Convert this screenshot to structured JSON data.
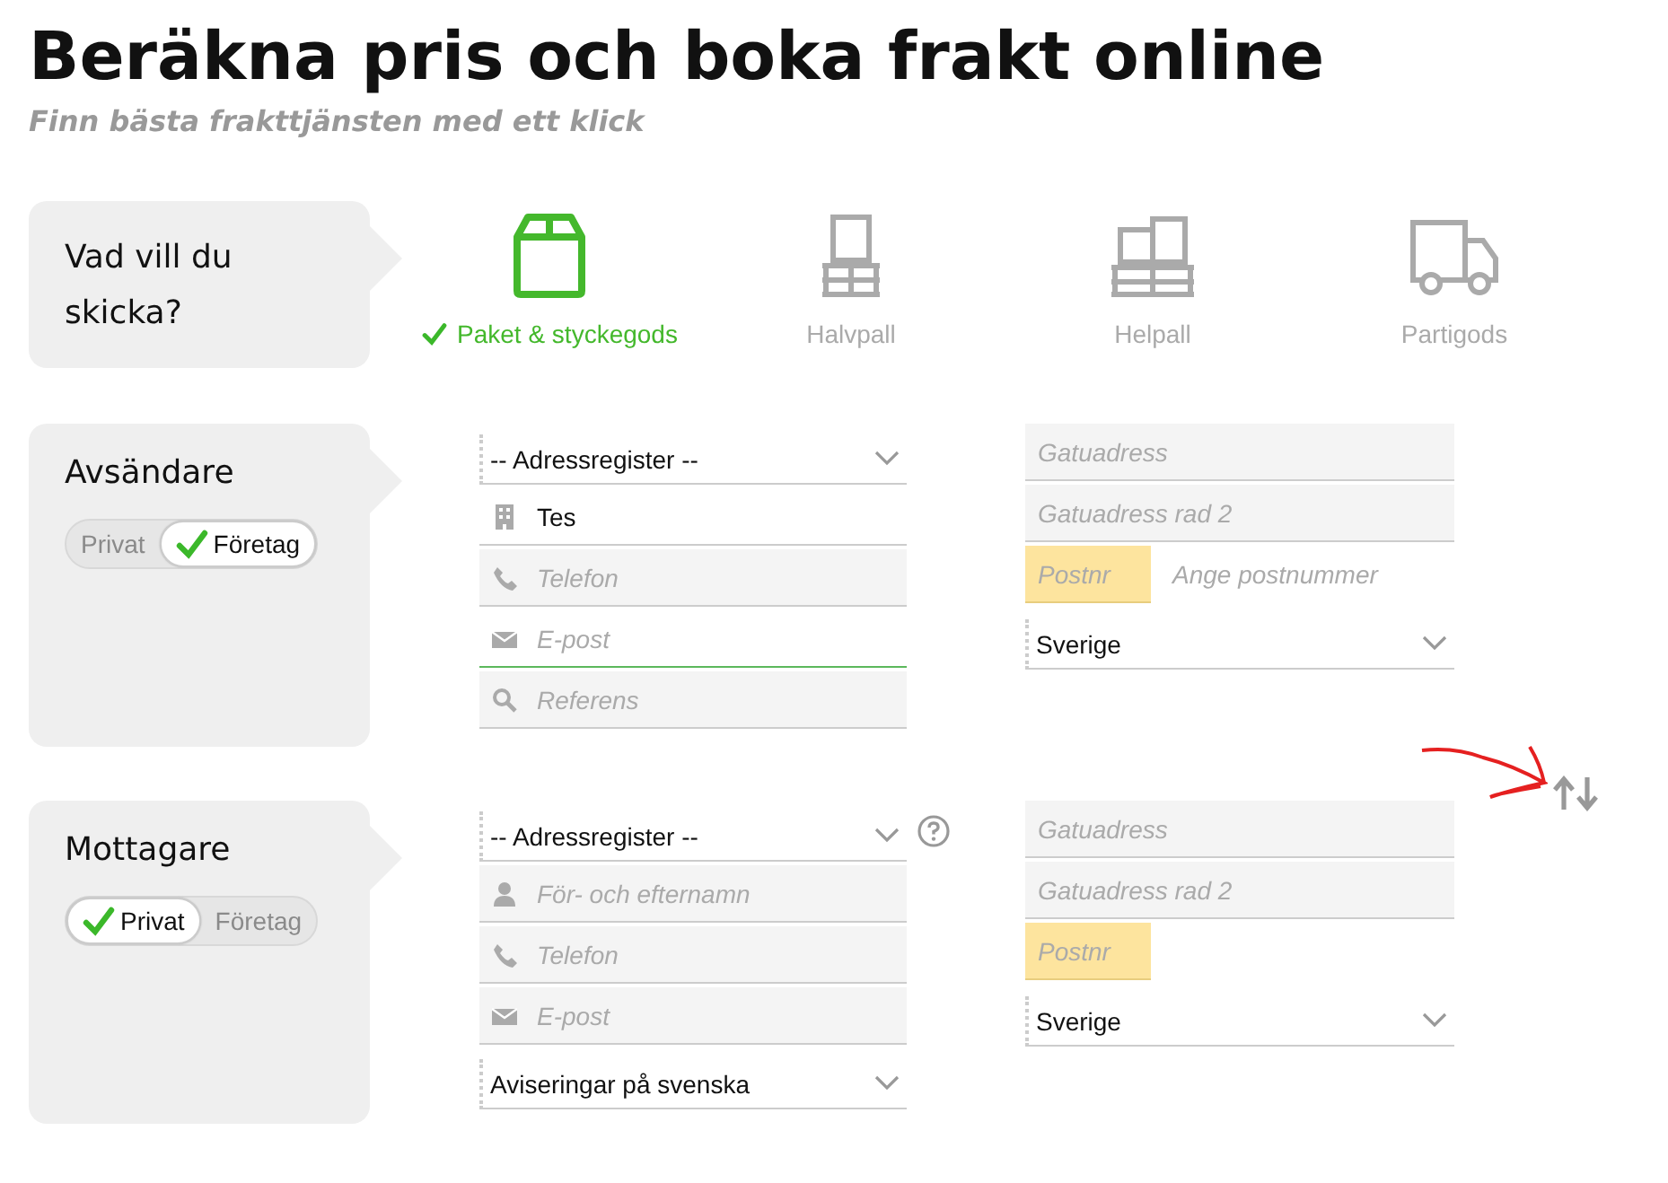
{
  "header": {
    "title": "Beräkna pris och boka frakt online",
    "subtitle": "Finn bästa frakttjänsten med ett klick"
  },
  "shipment": {
    "label": "Vad vill du skicka?",
    "options": [
      {
        "label": "Paket & styckegods",
        "kind": "parcel",
        "selected": true
      },
      {
        "label": "Halvpall",
        "kind": "halfpallet",
        "selected": false
      },
      {
        "label": "Helpall",
        "kind": "pallet",
        "selected": false
      },
      {
        "label": "Partigods",
        "kind": "truckload",
        "selected": false
      }
    ]
  },
  "parties": [
    {
      "label": "Avsändare",
      "toggle": [
        {
          "label": "Privat",
          "selected": false
        },
        {
          "label": "Företag",
          "selected": true
        }
      ],
      "fields": [
        {
          "kind": "select",
          "value": "-- Adressregister --",
          "help": false
        },
        {
          "kind": "company",
          "value": "Tes"
        },
        {
          "kind": "phone",
          "placeholder": "Telefon"
        },
        {
          "kind": "email",
          "placeholder": "E-post",
          "focused": true
        },
        {
          "kind": "reference",
          "placeholder": "Referens"
        }
      ],
      "address": [
        {
          "kind": "input",
          "placeholder": "Gatuadress"
        },
        {
          "kind": "input",
          "placeholder": "Gatuadress rad 2"
        },
        {
          "kind": "postcode",
          "placeholder": "Postnr",
          "hint": "Ange postnummer"
        },
        {
          "kind": "select",
          "value": "Sverige"
        }
      ]
    },
    {
      "label": "Mottagare",
      "toggle": [
        {
          "label": "Privat",
          "selected": true
        },
        {
          "label": "Företag",
          "selected": false
        }
      ],
      "fields": [
        {
          "kind": "select",
          "value": "-- Adressregister --",
          "help": true
        },
        {
          "kind": "name",
          "placeholder": "För- och efternamn"
        },
        {
          "kind": "phone",
          "placeholder": "Telefon"
        },
        {
          "kind": "email",
          "placeholder": "E-post"
        },
        {
          "kind": "select",
          "value": "Aviseringar på svenska"
        }
      ],
      "address": [
        {
          "kind": "input",
          "placeholder": "Gatuadress"
        },
        {
          "kind": "input",
          "placeholder": "Gatuadress rad 2"
        },
        {
          "kind": "postcode",
          "placeholder": "Postnr"
        },
        {
          "kind": "select",
          "value": "Sverige"
        }
      ]
    }
  ]
}
